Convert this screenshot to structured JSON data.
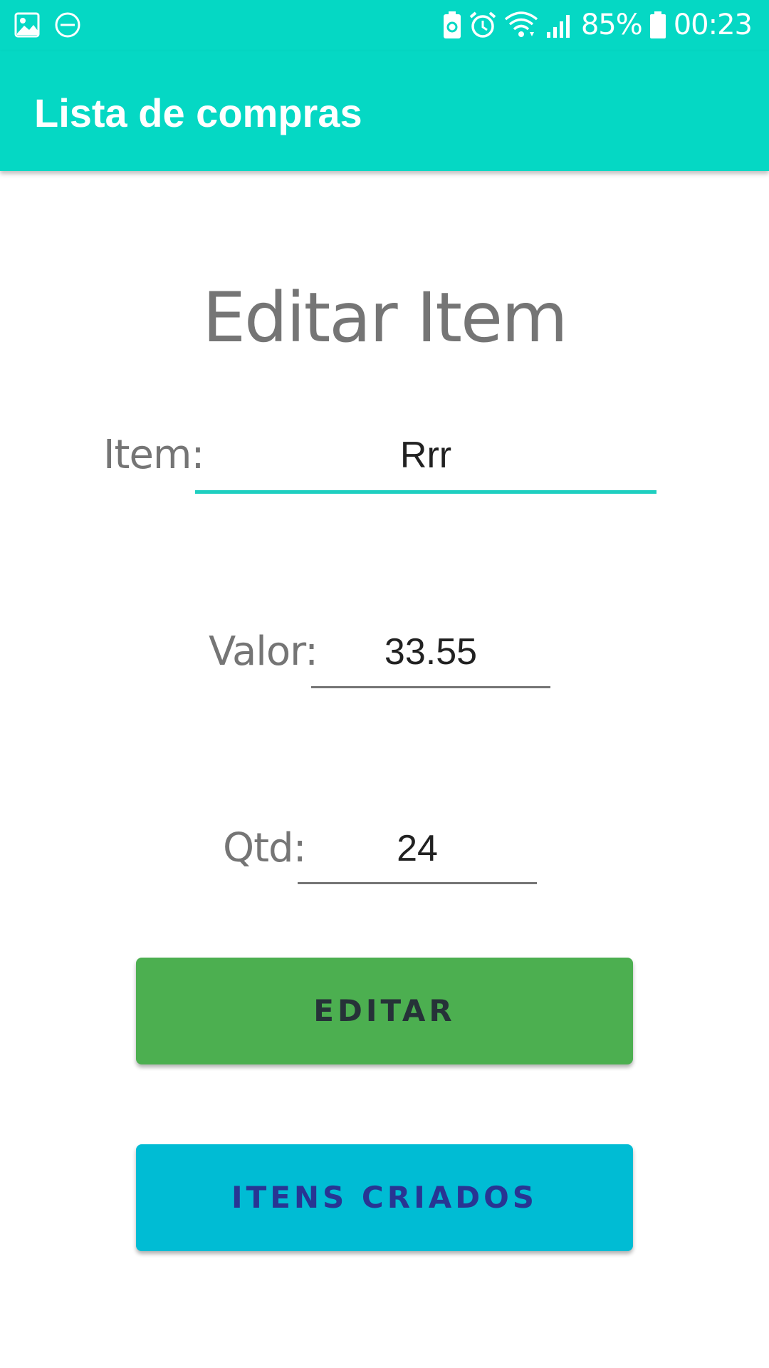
{
  "status_bar": {
    "battery_percent": "85%",
    "time": "00:23",
    "left_icons": [
      "image-icon",
      "do-not-disturb-icon"
    ],
    "right_icons": [
      "battery-saver-icon",
      "alarm-icon",
      "wifi-icon",
      "signal-icon",
      "battery-icon"
    ]
  },
  "app_bar": {
    "title": "Lista de compras"
  },
  "heading": "Editar Item",
  "form": {
    "item": {
      "label": "Item:",
      "value": "Rrr"
    },
    "valor": {
      "label": "Valor:",
      "value": "33.55"
    },
    "qtd": {
      "label": "Qtd:",
      "value": "24"
    }
  },
  "buttons": {
    "edit_label": "EDITAR",
    "list_label": "ITENS CRIADOS"
  },
  "colors": {
    "primary": "#05d8c4",
    "edit_button": "#4caf50",
    "list_button": "#00bcd4",
    "list_button_text": "#283593"
  }
}
